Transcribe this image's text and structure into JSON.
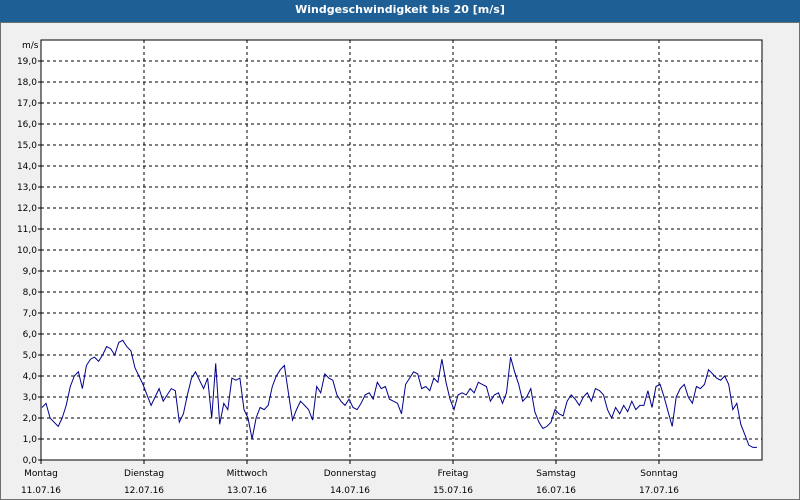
{
  "window": {
    "title": "Windgeschwindigkeit bis 20 [m/s]"
  },
  "chart_data": {
    "type": "line",
    "title": "Windgeschwindigkeit bis 20 [m/s]",
    "y_unit_label": "m/s",
    "ylim": [
      0,
      20
    ],
    "y_ticks": [
      "0,0",
      "1,0",
      "2,0",
      "3,0",
      "4,0",
      "5,0",
      "6,0",
      "7,0",
      "8,0",
      "9,0",
      "10,0",
      "11,0",
      "12,0",
      "13,0",
      "14,0",
      "15,0",
      "16,0",
      "17,0",
      "18,0",
      "19,0"
    ],
    "x_ticks": [
      {
        "day": "Montag",
        "date": "11.07.16"
      },
      {
        "day": "Dienstag",
        "date": "12.07.16"
      },
      {
        "day": "Mittwoch",
        "date": "13.07.16"
      },
      {
        "day": "Donnerstag",
        "date": "14.07.16"
      },
      {
        "day": "Freitag",
        "date": "15.07.16"
      },
      {
        "day": "Samstag",
        "date": "16.07.16"
      },
      {
        "day": "Sonntag",
        "date": "17.07.16"
      }
    ],
    "grid": true,
    "series_color": "#00008b",
    "series": [
      {
        "values": [
          2.5,
          2.7,
          2.0,
          1.8,
          1.6,
          2.0,
          2.6,
          3.5,
          4.0,
          4.2,
          3.4,
          4.5,
          4.8,
          4.9,
          4.7,
          5.0,
          5.4,
          5.3,
          5.0,
          5.6,
          5.7,
          5.4,
          5.2,
          4.4,
          4.0,
          3.6,
          3.1,
          2.6,
          3.0,
          3.4,
          2.8,
          3.1,
          3.4,
          3.3,
          1.8,
          2.2,
          3.1,
          3.9,
          4.2,
          3.8,
          3.4,
          3.9,
          2.0,
          4.6,
          1.7,
          2.7,
          2.4,
          3.9,
          3.8,
          3.9,
          2.4,
          2.0,
          1.0,
          2.0,
          2.5,
          2.4,
          2.6,
          3.5,
          4.0,
          4.3,
          4.5,
          3.2,
          1.9,
          2.4,
          2.8,
          2.6,
          2.4,
          1.9,
          3.5,
          3.2,
          4.1,
          3.9,
          3.8,
          3.1,
          2.8,
          2.6,
          2.9,
          2.5,
          2.4,
          2.7,
          3.1,
          3.2,
          2.9,
          3.7,
          3.4,
          3.5,
          2.9,
          2.8,
          2.7,
          2.2,
          3.6,
          3.9,
          4.2,
          4.1,
          3.4,
          3.5,
          3.3,
          3.9,
          3.7,
          4.8,
          3.7,
          2.9,
          2.4,
          3.1,
          3.2,
          3.1,
          3.4,
          3.2,
          3.7,
          3.6,
          3.5,
          2.8,
          3.1,
          3.2,
          2.7,
          3.2,
          4.9,
          4.2,
          3.6,
          2.8,
          3.0,
          3.4,
          2.3,
          1.8,
          1.5,
          1.6,
          1.8,
          2.4,
          2.2,
          2.1,
          2.8,
          3.1,
          2.9,
          2.6,
          3.0,
          3.2,
          2.8,
          3.4,
          3.3,
          3.1,
          2.4,
          2.0,
          2.5,
          2.2,
          2.6,
          2.3,
          2.8,
          2.4,
          2.6,
          2.6,
          3.3,
          2.5,
          3.5,
          3.6,
          3.0,
          2.3,
          1.6,
          3.0,
          3.4,
          3.6,
          3.0,
          2.7,
          3.5,
          3.4,
          3.6,
          4.3,
          4.1,
          3.9,
          3.8,
          4.0,
          3.6,
          2.4,
          2.7,
          1.7,
          1.2,
          0.7,
          0.6,
          0.6
        ]
      }
    ]
  }
}
